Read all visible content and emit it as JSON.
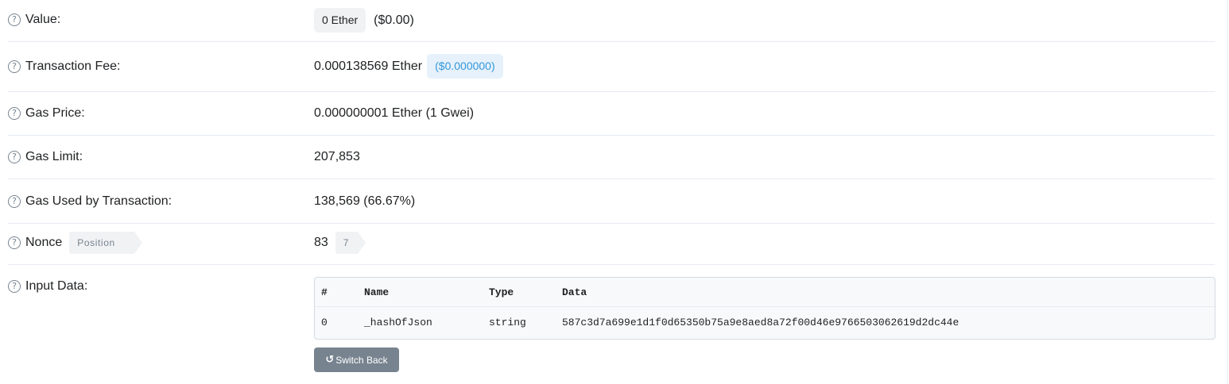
{
  "rows": {
    "value": {
      "label": "Value:",
      "amount": "0 Ether",
      "usd": "($0.00)"
    },
    "fee": {
      "label": "Transaction Fee:",
      "amount": "0.000138569 Ether",
      "usd": "($0.000000)"
    },
    "gas_price": {
      "label": "Gas Price:",
      "amount": "0.000000001 Ether (1 Gwei)"
    },
    "gas_limit": {
      "label": "Gas Limit:",
      "amount": "207,853"
    },
    "gas_used": {
      "label": "Gas Used by Transaction:",
      "amount": "138,569 (66.67%)"
    },
    "nonce": {
      "label": "Nonce",
      "position_badge": "Position",
      "amount": "83",
      "position_value": "7"
    },
    "input_data": {
      "label": "Input Data:"
    }
  },
  "help_icon_glyph": "?",
  "input_table": {
    "headers": [
      "#",
      "Name",
      "Type",
      "Data"
    ],
    "rows": [
      [
        "0",
        "_hashOfJson",
        "string",
        "587c3d7a699e1d1f0d65350b75a9e8aed8a72f00d46e9766503062619d2dc44e"
      ]
    ]
  },
  "switch_back": {
    "icon": "undo-icon",
    "glyph": "↺",
    "label": "Switch Back"
  },
  "colors": {
    "text": "#1e2022",
    "muted": "#77838f",
    "link_blue": "#3498db",
    "divider": "#e7eaf3",
    "button_bg": "#77838f"
  }
}
